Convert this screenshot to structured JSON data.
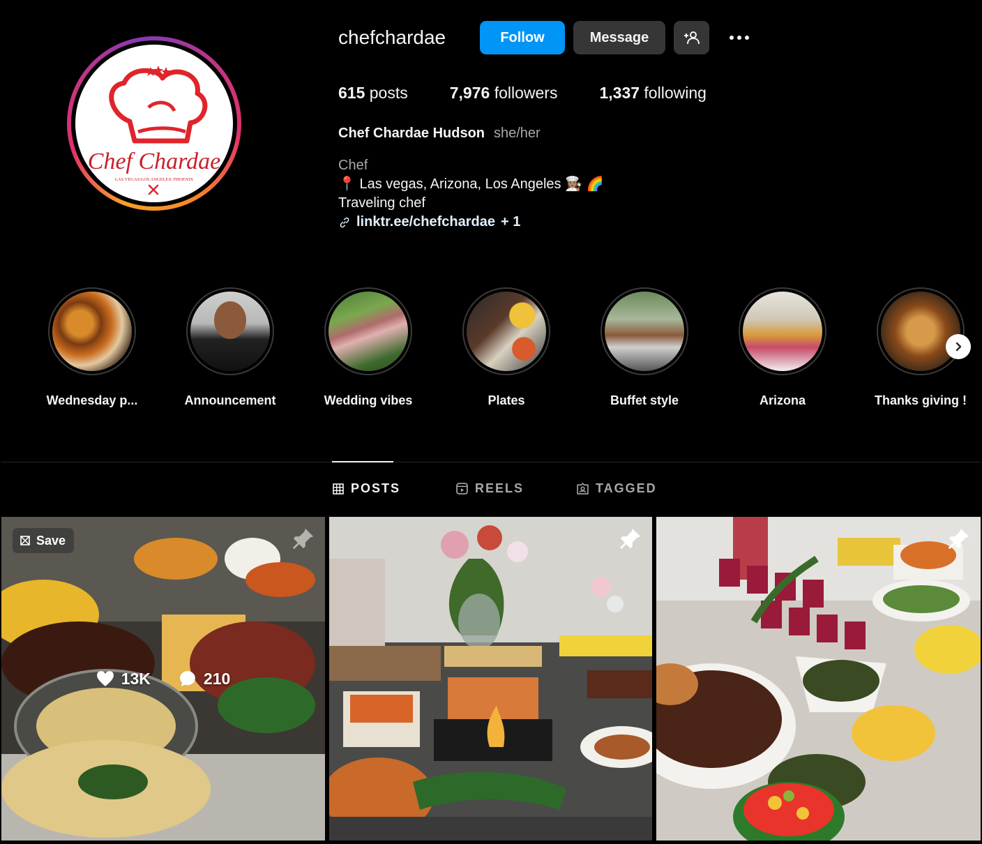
{
  "profile": {
    "username": "chefchardae",
    "follow_label": "Follow",
    "message_label": "Message",
    "logo_text": "Chef Chardae",
    "logo_subtext": "LAS VEGAS/LOS ANGELES/ PHOENIX"
  },
  "stats": {
    "posts_count": "615",
    "posts_label": " posts",
    "followers_count": "7,976",
    "followers_label": " followers",
    "following_count": "1,337",
    "following_label": " following"
  },
  "bio": {
    "full_name": "Chef Chardae Hudson",
    "pronouns": "she/her",
    "category": "Chef",
    "line1": "📍 Las vegas, Arizona, Los Angeles 👩🏽‍🍳 🌈",
    "line2": "Traveling chef",
    "link": "linktr.ee/chefchardae",
    "link_extra": " + 1"
  },
  "highlights": [
    {
      "label": "Wednesday p..."
    },
    {
      "label": "Announcement"
    },
    {
      "label": "Wedding vibes"
    },
    {
      "label": "Plates"
    },
    {
      "label": "Buffet style"
    },
    {
      "label": "Arizona"
    },
    {
      "label": "Thanks giving !"
    }
  ],
  "tabs": [
    {
      "label": "POSTS",
      "active": true
    },
    {
      "label": "REELS",
      "active": false
    },
    {
      "label": "TAGGED",
      "active": false
    }
  ],
  "posts": [
    {
      "save_label": "Save",
      "likes": "13K",
      "comments": "210"
    }
  ],
  "colors": {
    "follow_button": "#0095f6",
    "secondary_button": "#363636",
    "background": "#000000",
    "logo_red": "#e0242c"
  },
  "icons": [
    "add-user-icon",
    "more-options-icon",
    "link-icon",
    "chevron-right-icon",
    "grid-icon",
    "reels-icon",
    "tagged-icon",
    "save-icon",
    "pin-icon",
    "heart-icon",
    "comment-icon"
  ]
}
